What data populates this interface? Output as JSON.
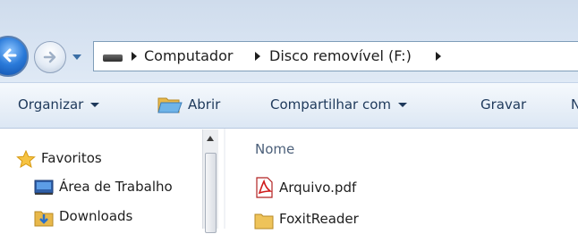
{
  "address_bar": {
    "crumbs": [
      "Computador",
      "Disco removível (F:)"
    ]
  },
  "toolbar": {
    "organize": "Organizar",
    "open": "Abrir",
    "share": "Compartilhar com",
    "burn": "Gravar",
    "overflow": "N"
  },
  "nav_pane": {
    "favorites": "Favoritos",
    "items": [
      {
        "label": "Área de Trabalho",
        "icon": "desktop-icon"
      },
      {
        "label": "Downloads",
        "icon": "downloads-folder-icon"
      }
    ]
  },
  "file_list": {
    "column_name": "Nome",
    "files": [
      {
        "name": "Arquivo.pdf",
        "icon": "pdf-file-icon"
      },
      {
        "name": "FoxitReader",
        "icon": "folder-icon"
      }
    ]
  },
  "colors": {
    "toolbar_text": "#1e395b",
    "column_header": "#4c607a",
    "address_border": "#7f9db9"
  }
}
